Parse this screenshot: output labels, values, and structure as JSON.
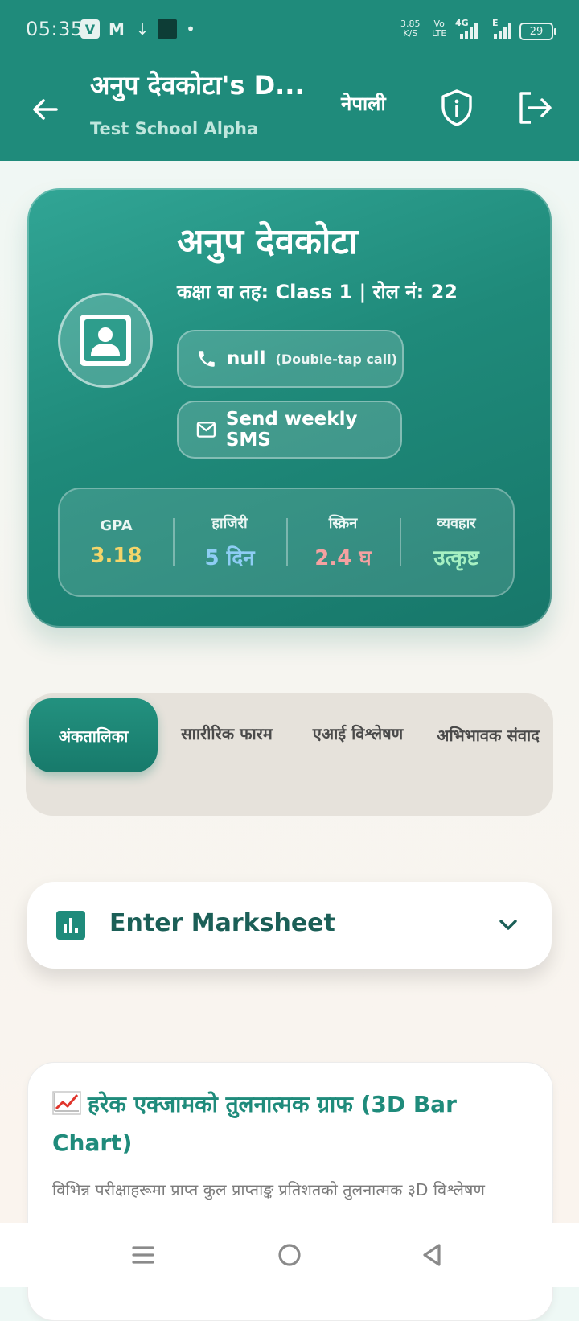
{
  "status_bar": {
    "time": "05:35",
    "net_speed_value": "3.85",
    "net_speed_unit": "K/S",
    "volte_top": "Vo",
    "volte_bottom": "LTE",
    "network_4g": "4G",
    "network_e": "E",
    "battery": "29"
  },
  "app_bar": {
    "title": "अनुप देवकोटा's D...",
    "subtitle": "Test School Alpha",
    "language_label": "नेपाली"
  },
  "profile": {
    "name": "अनुप देवकोटा",
    "meta": "कक्षा वा तह: Class 1 | रोल नं: 22",
    "call_label": "null",
    "call_hint": "(Double-tap call)",
    "sms_label": "Send weekly SMS",
    "stats": [
      {
        "key": "GPA",
        "value": "3.18",
        "color": "#f4d56a"
      },
      {
        "key": "हाजिरी",
        "value": "5 दिन",
        "color": "#8ecdf4"
      },
      {
        "key": "स्क्रिन",
        "value": "2.4 घ",
        "color": "#f4a1a1"
      },
      {
        "key": "व्यवहार",
        "value": "उत्कृष्ट",
        "color": "#a6f0c2"
      }
    ]
  },
  "tabs": [
    {
      "label": "अंकतालिका",
      "active": true
    },
    {
      "label": "साारीरिक फारम",
      "active": false
    },
    {
      "label": "एआई विश्लेषण",
      "active": false
    },
    {
      "label": "अभिभावक संवाद",
      "active": false
    }
  ],
  "marksheet": {
    "title": "Enter Marksheet"
  },
  "graph_card": {
    "title": "हरेक एक्जामको तुलनात्मक ग्राफ (3D Bar Chart)",
    "description": "विभिन्न परीक्षाहरूमा प्राप्त कुल प्राप्ताङ्क प्रतिशतको तुलनात्मक ३D विश्लेषण"
  },
  "colors": {
    "primary": "#1f8b7b",
    "tab_bg": "#e6e2db"
  }
}
